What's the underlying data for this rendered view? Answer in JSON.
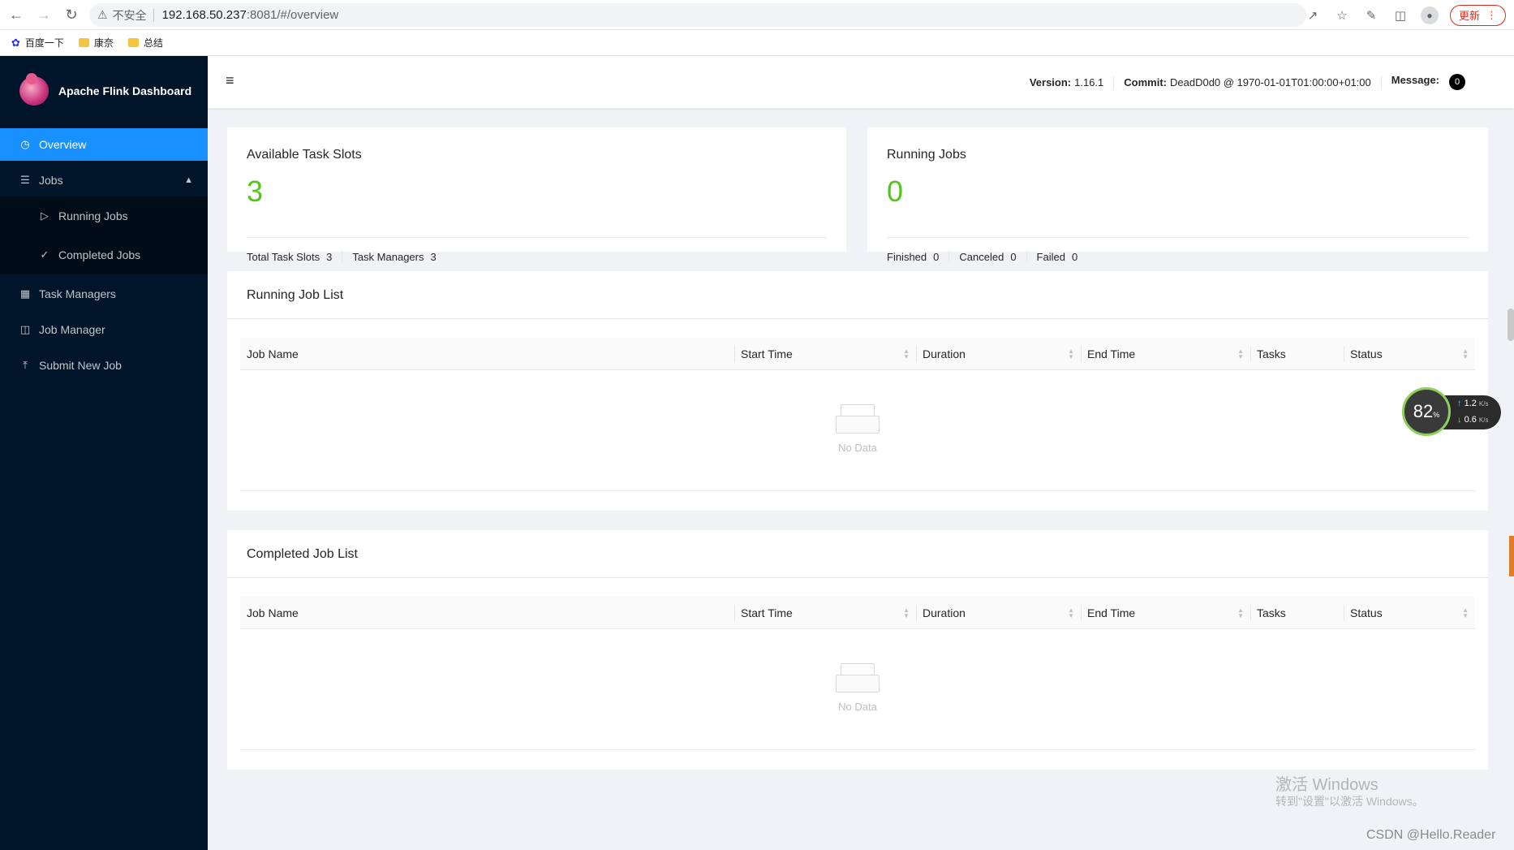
{
  "browser": {
    "insecure_label": "不安全",
    "url_host": "192.168.50.237",
    "url_rest": ":8081/#/overview",
    "update_label": "更新",
    "bookmarks": [
      "百度一下",
      "康奈",
      "总结"
    ]
  },
  "app": {
    "title": "Apache Flink Dashboard"
  },
  "sidebar": {
    "items": [
      {
        "label": "Overview",
        "icon": "dashboard-icon",
        "active": true
      },
      {
        "label": "Jobs",
        "icon": "list-icon"
      },
      {
        "label": "Task Managers",
        "icon": "schedule-icon"
      },
      {
        "label": "Job Manager",
        "icon": "cluster-icon"
      },
      {
        "label": "Submit New Job",
        "icon": "upload-icon"
      }
    ],
    "jobs_sub": [
      {
        "label": "Running Jobs",
        "icon": "play-circle-icon"
      },
      {
        "label": "Completed Jobs",
        "icon": "check-circle-icon"
      }
    ]
  },
  "header": {
    "version_label": "Version:",
    "version_value": "1.16.1",
    "commit_label": "Commit:",
    "commit_value": "DeadD0d0 @ 1970-01-01T01:00:00+01:00",
    "message_label": "Message:",
    "message_count": "0"
  },
  "slots": {
    "title": "Available Task Slots",
    "value": "3",
    "total_label": "Total Task Slots",
    "total_value": "3",
    "tm_label": "Task Managers",
    "tm_value": "3"
  },
  "running": {
    "title": "Running Jobs",
    "value": "0",
    "finished_label": "Finished",
    "finished_value": "0",
    "canceled_label": "Canceled",
    "canceled_value": "0",
    "failed_label": "Failed",
    "failed_value": "0"
  },
  "running_list": {
    "title": "Running Job List",
    "columns": [
      "Job Name",
      "Start Time",
      "Duration",
      "End Time",
      "Tasks",
      "Status"
    ],
    "empty": "No Data"
  },
  "completed_list": {
    "title": "Completed Job List",
    "columns": [
      "Job Name",
      "Start Time",
      "Duration",
      "End Time",
      "Tasks",
      "Status"
    ],
    "empty": "No Data"
  },
  "net_widget": {
    "percent": "82",
    "percent_unit": "%",
    "up": "1.2",
    "down": "0.6",
    "unit": "K/s"
  },
  "watermark": {
    "line1": "激活 Windows",
    "line2": "转到\"设置\"以激活 Windows。",
    "csdn": "CSDN @Hello.Reader"
  }
}
